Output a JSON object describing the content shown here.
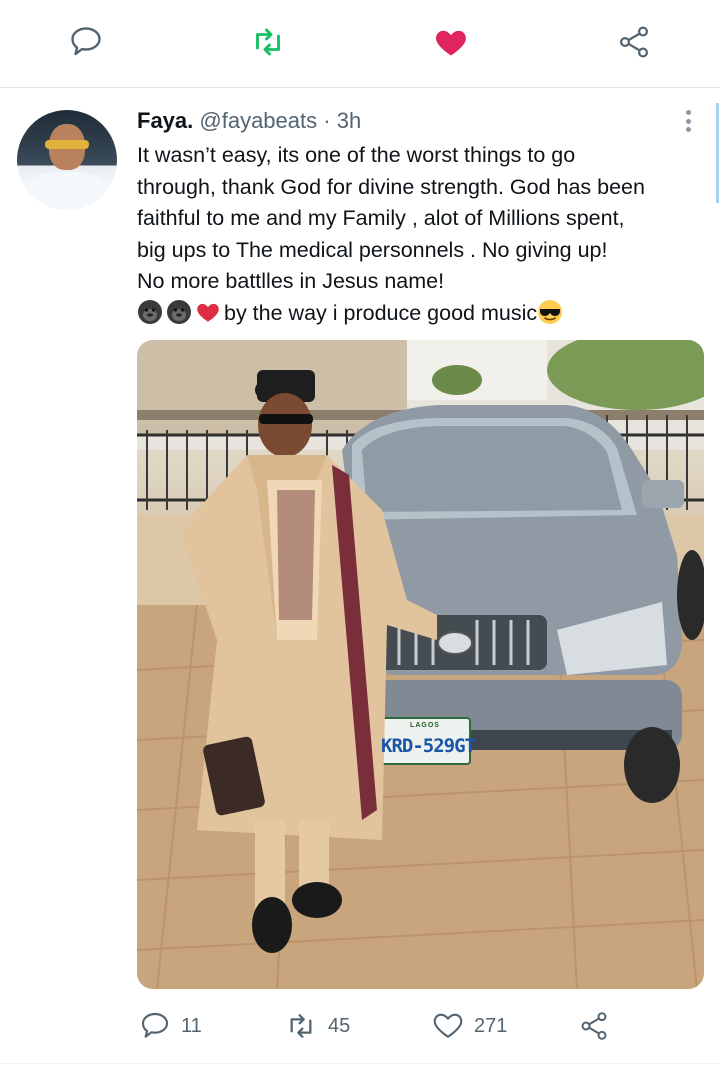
{
  "top_actions": {
    "reply_icon": "speech-bubble-icon",
    "retweet_icon": "retweet-icon",
    "like_icon": "heart-filled-icon",
    "share_icon": "share-icon",
    "colors": {
      "retweet": "#17bf63",
      "like": "#e0245e",
      "default": "#536471"
    }
  },
  "tweet": {
    "name": "Faya.",
    "username": "@fayabeats",
    "separator": "·",
    "time": "3h",
    "lines": [
      "It wasn’t easy, its one of the worst things to go",
      "through, thank God for divine strength. God has been",
      "faithful to me and my Family , alot of Millions spent,",
      "big ups to The medical personnels . No giving up!",
      "No more battlles in Jesus name!"
    ],
    "last_line_text": "by the way i produce good music",
    "emojis": [
      "gorilla",
      "gorilla",
      "red-heart",
      "smiling-face-with-sunglasses"
    ],
    "plate": {
      "top": "LAGOS",
      "number": "KRD-529GT"
    }
  },
  "bottom_actions": {
    "reply_count": "11",
    "retweet_count": "45",
    "like_count": "271"
  }
}
